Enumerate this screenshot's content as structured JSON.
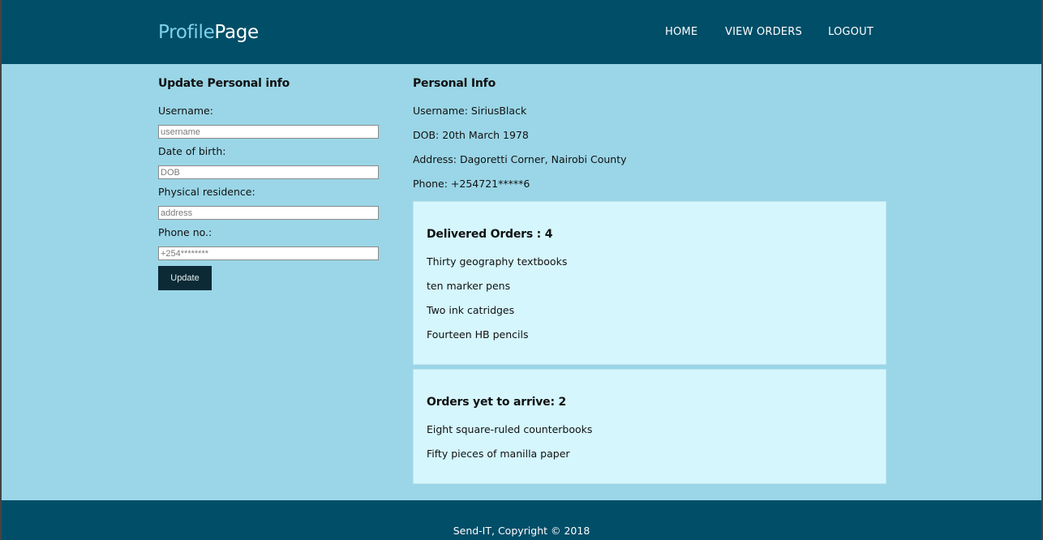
{
  "header": {
    "brand_part1": "Profile",
    "brand_part2": "Page",
    "nav": {
      "home": "HOME",
      "view_orders": "VIEW ORDERS",
      "logout": "LOGOUT"
    }
  },
  "update_form": {
    "title": "Update Personal info",
    "username_label": "Username:",
    "username_placeholder": "username",
    "dob_label": "Date of birth:",
    "dob_placeholder": "DOB",
    "residence_label": "Physical residence:",
    "residence_placeholder": "address",
    "phone_label": "Phone no.:",
    "phone_placeholder": "+254********",
    "update_button": "Update"
  },
  "personal_info": {
    "title": "Personal Info",
    "username": "Username: SiriusBlack",
    "dob": "DOB: 20th March 1978",
    "address": "Address: Dagoretti Corner, Nairobi County",
    "phone": "Phone: +254721*****6"
  },
  "delivered_orders": {
    "title": "Delivered Orders : 4",
    "items": [
      "Thirty geography textbooks",
      "ten marker pens",
      "Two ink catridges",
      "Fourteen HB pencils"
    ]
  },
  "pending_orders": {
    "title": "Orders yet to arrive: 2",
    "items": [
      "Eight square-ruled counterbooks",
      "Fifty pieces of manilla paper"
    ]
  },
  "footer": {
    "copyright": "Send-IT, Copyright © 2018"
  },
  "colors": {
    "header_bg": "#004e68",
    "page_bg": "#9ad6e7",
    "card_bg": "#d5f6fd",
    "button_bg": "#0b2a35",
    "brand_accent": "#7fd2ea"
  }
}
